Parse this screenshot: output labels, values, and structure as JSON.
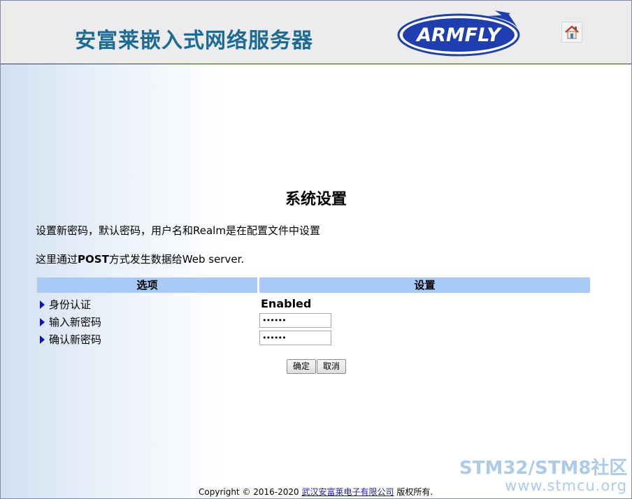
{
  "header": {
    "site_title": "安富莱嵌入式网络服务器",
    "logo_text": "ARMFLY",
    "home_icon": "home-icon"
  },
  "main": {
    "heading": "系统设置",
    "description_1": "设置新密码，默认密码，用户名和Realm是在配置文件中设置",
    "description_2_prefix": "这里通过",
    "description_2_bold": "POST",
    "description_2_suffix": "方式发生数据给Web server.",
    "table": {
      "headers": [
        "选项",
        "设置"
      ],
      "rows": [
        {
          "label": "身份认证",
          "value": "Enabled"
        },
        {
          "label": "输入新密码",
          "value": "••••••"
        },
        {
          "label": "确认新密码",
          "value": "••••••"
        }
      ]
    },
    "buttons": {
      "ok": "确定",
      "cancel": "取消"
    }
  },
  "footer": {
    "copyright": "Copyright © 2016-2020",
    "company_link": "武汉安富莱电子有限公司",
    "rights": "版权所有."
  },
  "watermark": {
    "line1": "STM32/STM8社区",
    "line2": "www.stmcu.org"
  },
  "colors": {
    "title": "#1b6b95",
    "table_header": "#a9caf7",
    "logo_blue": "#1f3fb0"
  }
}
